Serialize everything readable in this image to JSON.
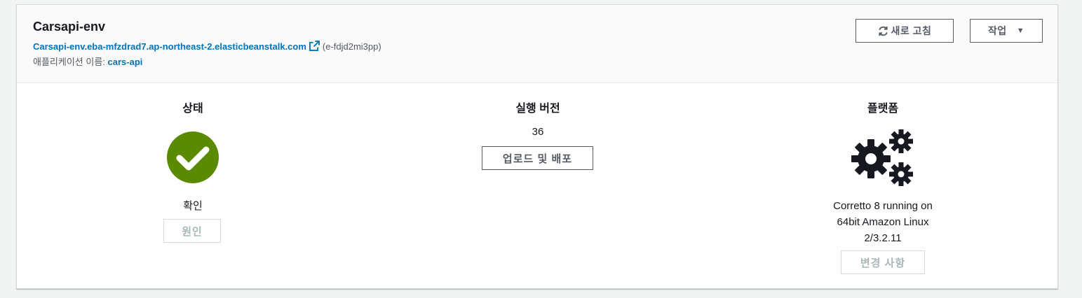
{
  "header": {
    "env_name": "Carsapi-env",
    "env_url": "Carsapi-env.eba-mfzdrad7.ap-northeast-2.elasticbeanstalk.com",
    "env_id": "(e-fdjd2mi3pp)",
    "app_label": "애플리케이션 이름:",
    "app_name": "cars-api",
    "refresh_label": "새로 고침",
    "actions_label": "작업",
    "icons": {
      "external": "external-link-icon",
      "refresh": "refresh-icon",
      "caret": "caret-down-icon"
    }
  },
  "status": {
    "title": "상태",
    "health": "확인",
    "cause_label": "원인",
    "icon": "check-circle-icon",
    "color": "#5a8a00"
  },
  "version": {
    "title": "실행 버전",
    "value": "36",
    "deploy_label": "업로드 및 배포"
  },
  "platform": {
    "title": "플랫폼",
    "line1": "Corretto 8 running on",
    "line2": "64bit Amazon Linux",
    "line3": "2/3.2.11",
    "change_label": "변경 사항",
    "icon": "gears-icon"
  },
  "colors": {
    "link": "#0073bb",
    "text": "#16191f",
    "muted": "#545b64",
    "disabled": "#aab7b8"
  }
}
